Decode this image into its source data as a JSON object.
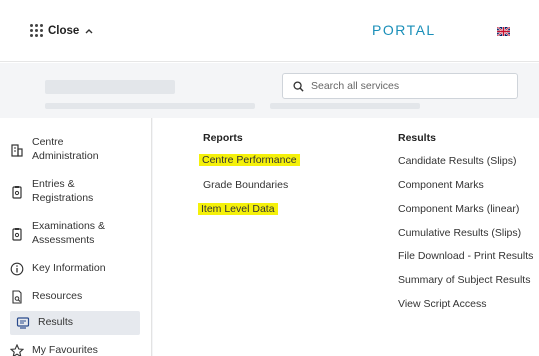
{
  "header": {
    "close_label": "Close",
    "portal_title": "PORTAL"
  },
  "search": {
    "placeholder": "Search all services"
  },
  "sidebar": {
    "items": [
      {
        "label": "Centre Administration",
        "line1": "Centre",
        "line2": "Administration",
        "icon": "building-icon"
      },
      {
        "label": "Entries & Registrations",
        "line1": "Entries &",
        "line2": "Registrations",
        "icon": "clipboard-icon"
      },
      {
        "label": "Examinations & Assessments",
        "line1": "Examinations &",
        "line2": "Assessments",
        "icon": "clipboard-icon"
      },
      {
        "label": "Key Information",
        "icon": "info-icon"
      },
      {
        "label": "Resources",
        "icon": "document-search-icon"
      },
      {
        "label": "Results",
        "icon": "monitor-icon",
        "active": true
      },
      {
        "label": "My Favourites",
        "icon": "star-icon"
      }
    ]
  },
  "menu": {
    "reports_heading": "Reports",
    "reports": [
      {
        "label": "Centre Performance",
        "highlighted": true
      },
      {
        "label": "Grade Boundaries",
        "highlighted": false
      },
      {
        "label": "Item Level Data",
        "highlighted": true
      }
    ],
    "results_heading": "Results",
    "results": [
      {
        "label": "Candidate Results (Slips)"
      },
      {
        "label": "Component Marks"
      },
      {
        "label": "Component Marks (linear)"
      },
      {
        "label": "Cumulative Results (Slips)"
      },
      {
        "label": "File Download - Print Results"
      },
      {
        "label": "Summary of Subject Results"
      },
      {
        "label": "View Script Access"
      }
    ]
  },
  "colors": {
    "accent": "#1a8fb9",
    "highlight": "#f5f10a",
    "active_bg": "#e6e9ee"
  }
}
